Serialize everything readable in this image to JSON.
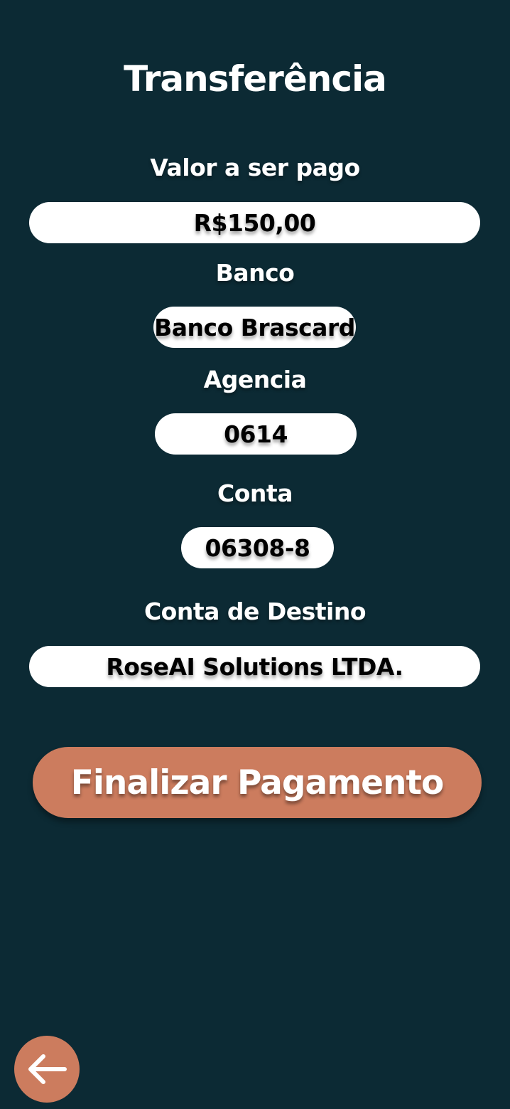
{
  "header": {
    "title": "Transferência"
  },
  "form": {
    "amount_label": "Valor a ser pago",
    "amount_value": "R$150,00",
    "bank_label": "Banco",
    "bank_value": "Banco Brascard",
    "agency_label": "Agencia",
    "agency_value": "0614",
    "account_label": "Conta",
    "account_value": "06308-8",
    "destination_label": "Conta de Destino",
    "destination_value": "RoseAI Solutions LTDA."
  },
  "actions": {
    "finalize_label": "Finalizar Pagamento",
    "back_icon": "arrow-left-icon"
  },
  "colors": {
    "background": "#0c2a34",
    "accent": "#cc7c5e",
    "field": "#ffffff"
  }
}
